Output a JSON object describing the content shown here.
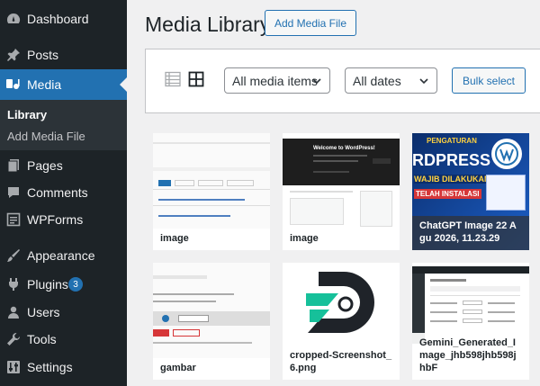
{
  "sidebar": {
    "items": [
      {
        "label": "Dashboard",
        "icon": "dashboard-icon"
      },
      {
        "label": "Posts",
        "icon": "pin-icon"
      },
      {
        "label": "Media",
        "icon": "media-icon"
      },
      {
        "label": "Pages",
        "icon": "pages-icon"
      },
      {
        "label": "Comments",
        "icon": "comments-icon"
      },
      {
        "label": "WPForms",
        "icon": "wpforms-icon"
      },
      {
        "label": "Appearance",
        "icon": "appearance-icon"
      },
      {
        "label": "Plugins",
        "icon": "plugins-icon",
        "badge": "3"
      },
      {
        "label": "Users",
        "icon": "users-icon"
      },
      {
        "label": "Tools",
        "icon": "tools-icon"
      },
      {
        "label": "Settings",
        "icon": "settings-icon"
      }
    ],
    "submenu": [
      "Library",
      "Add Media File"
    ]
  },
  "header": {
    "title": "Media Library",
    "add_button": "Add Media File"
  },
  "toolbar": {
    "filter_type": "All media items",
    "filter_date": "All dates",
    "bulk_select": "Bulk select"
  },
  "thumb_text": {
    "welcome": "Welcome to WordPress!",
    "pengaturan_1": "PENGATURAN",
    "pengaturan_2": "RDPRESS",
    "pengaturan_3": "WAJIB DILAKUKAN",
    "pengaturan_4": "TELAH INSTALASI",
    "cropped_logo": "D"
  },
  "media": [
    {
      "caption": "image"
    },
    {
      "caption": "image"
    },
    {
      "caption": "ChatGPT Image 22 Agu 2026, 11.23.29"
    },
    {
      "caption": "gambar"
    },
    {
      "caption": "cropped-Screenshot_6.png"
    },
    {
      "caption": "Gemini_Generated_Image_jhb598jhb598jhbF"
    }
  ],
  "colors": {
    "sidebar_bg": "#1d2327",
    "accent": "#2271b1",
    "page_bg": "#f0f0f1"
  }
}
